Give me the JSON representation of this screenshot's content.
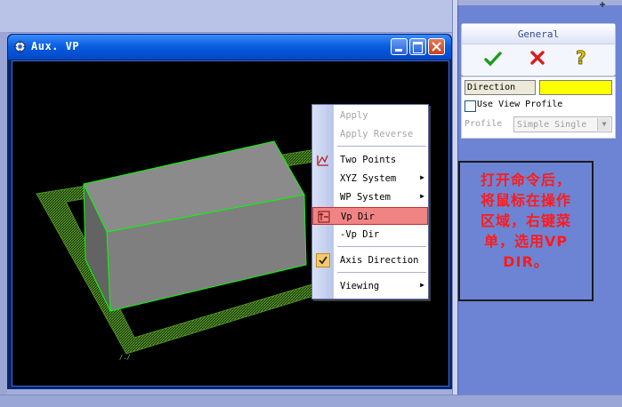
{
  "window": {
    "title": "Aux. VP",
    "minimize_icon": "minimize-icon",
    "maximize_icon": "maximize-icon",
    "close_icon": "close-icon"
  },
  "context_menu": {
    "items": [
      {
        "label": "Apply",
        "enabled": false
      },
      {
        "label": "Apply Reverse",
        "enabled": false
      },
      {
        "label": "Two Points",
        "icon": "two-points-icon"
      },
      {
        "label": "XYZ System",
        "submenu": true
      },
      {
        "label": "WP System",
        "submenu": true
      },
      {
        "label": "Vp Dir",
        "icon": "vp-dir-icon",
        "highlighted": true
      },
      {
        "label": "-Vp Dir"
      },
      {
        "label": "Axis Direction",
        "checked": true
      },
      {
        "label": "Viewing",
        "submenu": true
      }
    ],
    "highlight_color": "#f08484"
  },
  "panel": {
    "pin_icon": "pin-icon",
    "general": {
      "title": "General",
      "ok_icon": "check-icon",
      "cancel_icon": "cross-icon",
      "help_icon": "question-icon"
    },
    "direction_label": "Direction",
    "direction_value_color": "#ffff00",
    "use_view_profile_label": "Use View Profile",
    "use_view_profile_checked": false,
    "profile_label": "Profile",
    "profile_value": "Simple Single"
  },
  "annotation": {
    "lines": [
      "打开命令后，",
      "将鼠标在操作",
      "区域，右键菜",
      "单，选用VP",
      "DIR。"
    ],
    "text_color": "#ff1a1a"
  },
  "viewport": {
    "background": "#000000",
    "model_color": "#808080",
    "edge_color": "#00ff00",
    "plane_color": "#3f7a1e",
    "status_text": "/./"
  }
}
